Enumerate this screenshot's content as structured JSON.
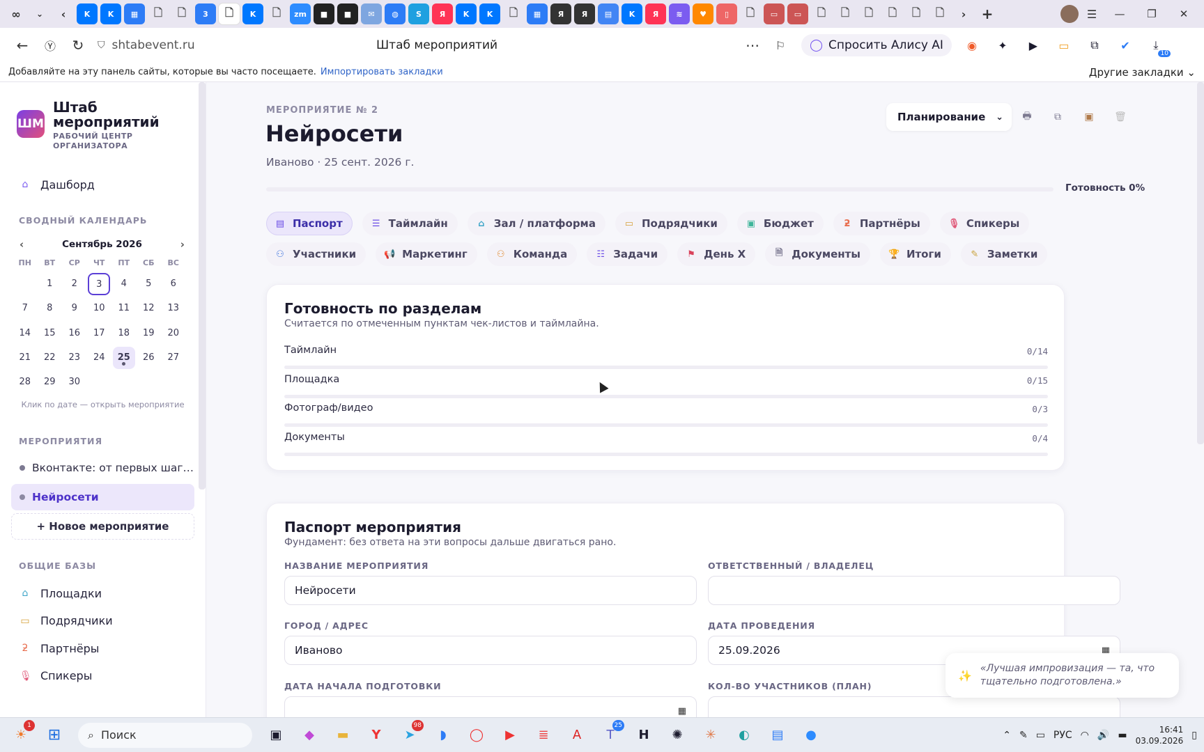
{
  "browser": {
    "url": "shtabevent.ru",
    "page_title": "Штаб мероприятий",
    "alisa_label": "Спросить Алису AI",
    "bookmarks_hint": "Добавляйте на эту панель сайты, которые вы часто посещаете.",
    "bookmarks_import": "Импортировать закладки",
    "bookmarks_other": "Другие закладки",
    "ext_badge": "10",
    "tabs": [
      {
        "icon": "vk-icon",
        "glyph": "K",
        "color": "#0077ff"
      },
      {
        "icon": "vk-icon",
        "glyph": "K",
        "color": "#0077ff"
      },
      {
        "icon": "apps-icon",
        "glyph": "▦",
        "color": "#2d7cf6"
      },
      {
        "icon": "doc-icon",
        "glyph": "🗋",
        "color": ""
      },
      {
        "icon": "doc-icon",
        "glyph": "🗋",
        "color": ""
      },
      {
        "icon": "3-icon",
        "glyph": "3",
        "color": "#2d7cf6"
      },
      {
        "icon": "doc-icon",
        "glyph": "🗋",
        "color": "",
        "active": true
      },
      {
        "icon": "vk-icon",
        "glyph": "K",
        "color": "#0077ff"
      },
      {
        "icon": "doc-icon",
        "glyph": "🗋",
        "color": ""
      },
      {
        "icon": "zoom-icon",
        "glyph": "zm",
        "color": "#2d8cff"
      },
      {
        "icon": "media-icon",
        "glyph": "■",
        "color": "#222"
      },
      {
        "icon": "media-icon",
        "glyph": "■",
        "color": "#222"
      },
      {
        "icon": "mail-icon",
        "glyph": "✉",
        "color": "#7ea6e0"
      },
      {
        "icon": "globe-icon",
        "glyph": "◍",
        "color": "#2d7cf6"
      },
      {
        "icon": "s-icon",
        "glyph": "S",
        "color": "#1fa0e0"
      },
      {
        "icon": "yandex-icon",
        "glyph": "Я",
        "color": "#f35"
      },
      {
        "icon": "vk-icon",
        "glyph": "K",
        "color": "#0077ff"
      },
      {
        "icon": "vk-icon",
        "glyph": "K",
        "color": "#0077ff"
      },
      {
        "icon": "doc-icon",
        "glyph": "🗋",
        "color": ""
      },
      {
        "icon": "apps-icon",
        "glyph": "▦",
        "color": "#2d7cf6"
      },
      {
        "icon": "yandex-icon",
        "glyph": "Я",
        "color": "#333"
      },
      {
        "icon": "yandex-icon",
        "glyph": "Я",
        "color": "#333"
      },
      {
        "icon": "docs-icon",
        "glyph": "▤",
        "color": "#4285f4"
      },
      {
        "icon": "vk-icon",
        "glyph": "K",
        "color": "#0077ff"
      },
      {
        "icon": "yandex-icon",
        "glyph": "Я",
        "color": "#f35"
      },
      {
        "icon": "stripes-icon",
        "glyph": "≋",
        "color": "#7b5cf0"
      },
      {
        "icon": "heart-icon",
        "glyph": "♥",
        "color": "#f80"
      },
      {
        "icon": "pdf-icon",
        "glyph": "▯",
        "color": "#e66"
      },
      {
        "icon": "doc-icon",
        "glyph": "🗋",
        "color": ""
      },
      {
        "icon": "slides-icon",
        "glyph": "▭",
        "color": "#c55"
      },
      {
        "icon": "slides-icon",
        "glyph": "▭",
        "color": "#c55"
      },
      {
        "icon": "doc-icon",
        "glyph": "🗋",
        "color": ""
      },
      {
        "icon": "doc-icon",
        "glyph": "🗋",
        "color": ""
      },
      {
        "icon": "doc-icon",
        "glyph": "🗋",
        "color": ""
      },
      {
        "icon": "doc-icon",
        "glyph": "🗋",
        "color": ""
      },
      {
        "icon": "doc-icon",
        "glyph": "🗋",
        "color": ""
      },
      {
        "icon": "doc-icon",
        "glyph": "🗋",
        "color": ""
      }
    ]
  },
  "brand": {
    "logo": "ШМ",
    "title_line1": "Штаб",
    "title_line2": "мероприятий",
    "sub_line1": "РАБОЧИЙ ЦЕНТР",
    "sub_line2": "ОРГАНИЗАТОРА"
  },
  "sidebar": {
    "dashboard": "Дашборд",
    "calendar_title": "СВОДНЫЙ КАЛЕНДАРЬ",
    "calendar_month": "Сентябрь 2026",
    "weekdays": [
      "ПН",
      "ВТ",
      "СР",
      "ЧТ",
      "ПТ",
      "СБ",
      "ВС"
    ],
    "calendar_hint": "Клик по дате — открыть мероприятие",
    "events_title": "МЕРОПРИЯТИЯ",
    "events": [
      "Вконтакте: от первых шаг…",
      "Нейросети"
    ],
    "new_event": "+ Новое мероприятие",
    "bases_title": "ОБЩИЕ БАЗЫ",
    "bases": [
      {
        "label": "Площадки",
        "icon": "house-icon",
        "glyph": "⌂",
        "color": "#3fa6c8"
      },
      {
        "label": "Подрядчики",
        "icon": "briefcase-icon",
        "glyph": "▭",
        "color": "#d6a23b"
      },
      {
        "label": "Партнёры",
        "icon": "link-icon",
        "glyph": "ƻ",
        "color": "#e86d4e"
      },
      {
        "label": "Спикеры",
        "icon": "mic-icon",
        "glyph": "🎙",
        "color": "#e05a7a"
      }
    ]
  },
  "event": {
    "number_label": "МЕРОПРИЯТИЕ № 2",
    "title": "Нейросети",
    "meta": "Иваново · 25 сент. 2026 г.",
    "stage": "Планирование",
    "readiness_label": "Готовность 0%",
    "readiness_value": 0,
    "tabs": [
      {
        "label": "Паспорт",
        "icon": "passport-icon",
        "glyph": "▤",
        "color": "#6b4de6",
        "active": true
      },
      {
        "label": "Таймлайн",
        "icon": "list-icon",
        "glyph": "☰",
        "color": "#6b4de6"
      },
      {
        "label": "Зал / платформа",
        "icon": "house-icon",
        "glyph": "⌂",
        "color": "#3fa6c8"
      },
      {
        "label": "Подрядчики",
        "icon": "briefcase-icon",
        "glyph": "▭",
        "color": "#d6a23b"
      },
      {
        "label": "Бюджет",
        "icon": "wallet-icon",
        "glyph": "▣",
        "color": "#3fb59a"
      },
      {
        "label": "Партнёры",
        "icon": "link-icon",
        "glyph": "ƻ",
        "color": "#e86d4e"
      },
      {
        "label": "Спикеры",
        "icon": "mic-icon",
        "glyph": "🎙",
        "color": "#e05a7a"
      },
      {
        "label": "Участники",
        "icon": "users-icon",
        "glyph": "⚇",
        "color": "#4a7de0"
      },
      {
        "label": "Маркетинг",
        "icon": "megaphone-icon",
        "glyph": "📢",
        "color": "#e2913b"
      },
      {
        "label": "Команда",
        "icon": "team-icon",
        "glyph": "⚇",
        "color": "#e2913b"
      },
      {
        "label": "Задачи",
        "icon": "tasks-icon",
        "glyph": "☷",
        "color": "#6b4de6"
      },
      {
        "label": "День Х",
        "icon": "flag-icon",
        "glyph": "⚑",
        "color": "#d9425b"
      },
      {
        "label": "Документы",
        "icon": "document-icon",
        "glyph": "🗎",
        "color": "#7a7790"
      },
      {
        "label": "Итоги",
        "icon": "trophy-icon",
        "glyph": "🏆",
        "color": "#3fb59a"
      },
      {
        "label": "Заметки",
        "icon": "pencil-icon",
        "glyph": "✎",
        "color": "#c9a23b"
      }
    ]
  },
  "readiness_card": {
    "title": "Готовность по разделам",
    "subtitle": "Считается по отмеченным пунктам чек-листов и таймлайна.",
    "rows": [
      {
        "label": "Таймлайн",
        "count": "0/14",
        "done": 0,
        "total": 14
      },
      {
        "label": "Площадка",
        "count": "0/15",
        "done": 0,
        "total": 15
      },
      {
        "label": "Фотограф/видео",
        "count": "0/3",
        "done": 0,
        "total": 3
      },
      {
        "label": "Документы",
        "count": "0/4",
        "done": 0,
        "total": 4
      }
    ]
  },
  "passport_card": {
    "title": "Паспорт мероприятия",
    "subtitle": "Фундамент: без ответа на эти вопросы дальше двигаться рано.",
    "fields": {
      "name_label": "НАЗВАНИЕ МЕРОПРИЯТИЯ",
      "name_value": "Нейросети",
      "owner_label": "ОТВЕТСТВЕННЫЙ / ВЛАДЕЛЕЦ",
      "owner_value": "",
      "city_label": "ГОРОД / АДРЕС",
      "city_value": "Иваново",
      "date_label": "ДАТА ПРОВЕДЕНИЯ",
      "date_value": "25.09.2026",
      "prep_label": "ДАТА НАЧАЛА ПОДГОТОВКИ",
      "prep_value": "",
      "count_label": "КОЛ-ВО УЧАСТНИКОВ (ПЛАН)",
      "count_value": ""
    }
  },
  "quote": "«Лучшая импровизация — та, что тщательно подготовлена.»",
  "taskbar": {
    "search_placeholder": "Поиск",
    "lang": "РУС",
    "time": "16:41",
    "date": "03.09.2026",
    "telegram_badge": "98",
    "teams_badge": "25",
    "weather_badge": "1"
  },
  "colors": {
    "accent": "#6b4de6",
    "accent_soft": "#ebe6fb"
  }
}
